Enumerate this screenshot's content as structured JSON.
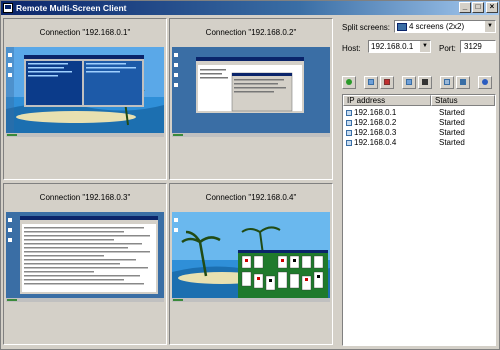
{
  "window": {
    "title": "Remote Multi-Screen Client"
  },
  "titlebar_buttons": {
    "minimize": "_",
    "maximize": "□",
    "close": "×"
  },
  "screens": [
    {
      "caption": "Connection \"192.168.0.1\""
    },
    {
      "caption": "Connection \"192.168.0.2\""
    },
    {
      "caption": "Connection \"192.168.0.3\""
    },
    {
      "caption": "Connection \"192.168.0.4\""
    }
  ],
  "controls": {
    "split_label": "Split screens:",
    "split_value": "4 screens (2x2)",
    "host_label": "Host:",
    "host_value": "192.168.0.1",
    "port_label": "Port:",
    "port_value": "3129"
  },
  "toolbar": {
    "icons": [
      "add-connection-icon",
      "connect-icon",
      "disconnect-icon",
      "start-icon",
      "stop-icon",
      "settings-icon",
      "properties-icon",
      "info-icon"
    ]
  },
  "list": {
    "col_ip": "IP address",
    "col_status": "Status",
    "rows": [
      {
        "ip": "192.168.0.1",
        "status": "Started"
      },
      {
        "ip": "192.168.0.2",
        "status": "Started"
      },
      {
        "ip": "192.168.0.3",
        "status": "Started"
      },
      {
        "ip": "192.168.0.4",
        "status": "Started"
      }
    ]
  },
  "colors": {
    "titlebar": "#0a246a",
    "face": "#d4d0c8",
    "desktop_blue": "#3a6ea5",
    "solitaire_green": "#1f7a2c"
  }
}
